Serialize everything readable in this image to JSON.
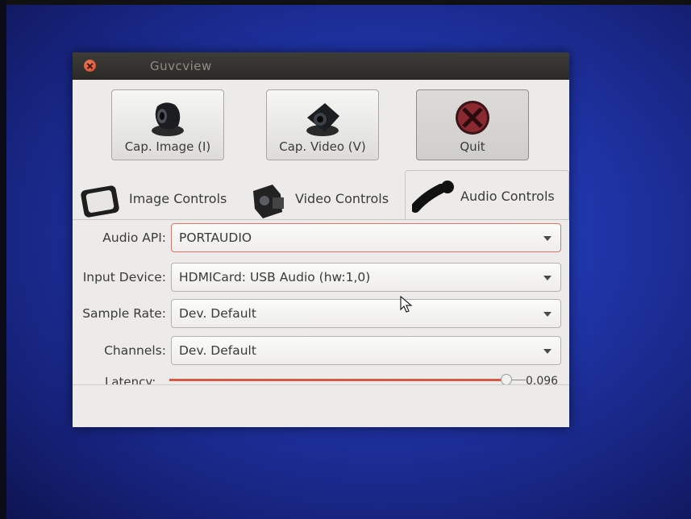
{
  "window": {
    "title": "Guvcview"
  },
  "toolbar": {
    "cap_image_label": "Cap. Image (I)",
    "cap_video_label": "Cap. Video (V)",
    "quit_label": "Quit"
  },
  "tabs": [
    {
      "label": "Image Controls"
    },
    {
      "label": "Video Controls"
    },
    {
      "label": "Audio Controls"
    }
  ],
  "active_tab": "Audio Controls",
  "audio": {
    "api": {
      "label": "Audio API:",
      "value": "PORTAUDIO"
    },
    "input_device": {
      "label": "Input Device:",
      "value": "HDMICard: USB Audio (hw:1,0)"
    },
    "sample_rate": {
      "label": "Sample Rate:",
      "value": "Dev. Default"
    },
    "channels": {
      "label": "Channels:",
      "value": "Dev. Default"
    },
    "latency": {
      "label": "Latency:",
      "value": "0.096"
    }
  },
  "colors": {
    "accent": "#d65846",
    "titlebar": "#2b2a27",
    "desktop": "#1f35a8"
  }
}
